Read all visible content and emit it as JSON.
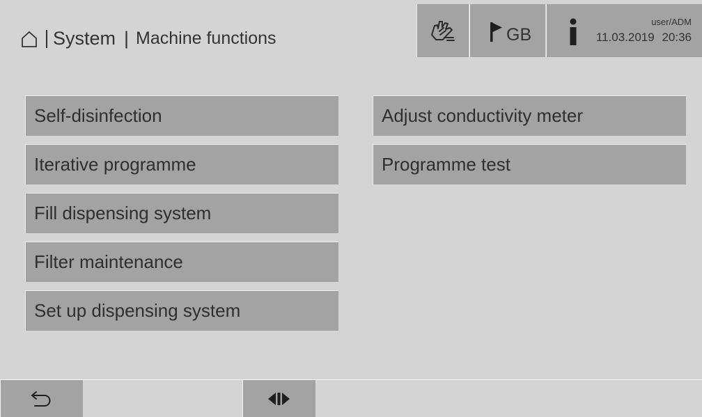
{
  "header": {
    "breadcrumb": {
      "system": "System",
      "separator": "|",
      "page": "Machine functions"
    },
    "language": "GB",
    "user": "user/ADM",
    "date": "11.03.2019",
    "time": "20:36"
  },
  "menu": {
    "left": [
      {
        "label": "Self-disinfection"
      },
      {
        "label": "Iterative programme"
      },
      {
        "label": "Fill dispensing system"
      },
      {
        "label": "Filter maintenance"
      },
      {
        "label": "Set up dispensing system"
      }
    ],
    "right": [
      {
        "label": "Adjust conductivity meter"
      },
      {
        "label": "Programme test"
      }
    ]
  },
  "icons": {
    "home": "home-icon",
    "hand": "hand-icon",
    "flag": "flag-icon",
    "person": "person-icon",
    "back": "back-arrow-icon",
    "toggle": "split-view-icon"
  },
  "colors": {
    "background": "#d4d4d4",
    "button": "#a3a3a3",
    "text": "#2b2b2b"
  }
}
